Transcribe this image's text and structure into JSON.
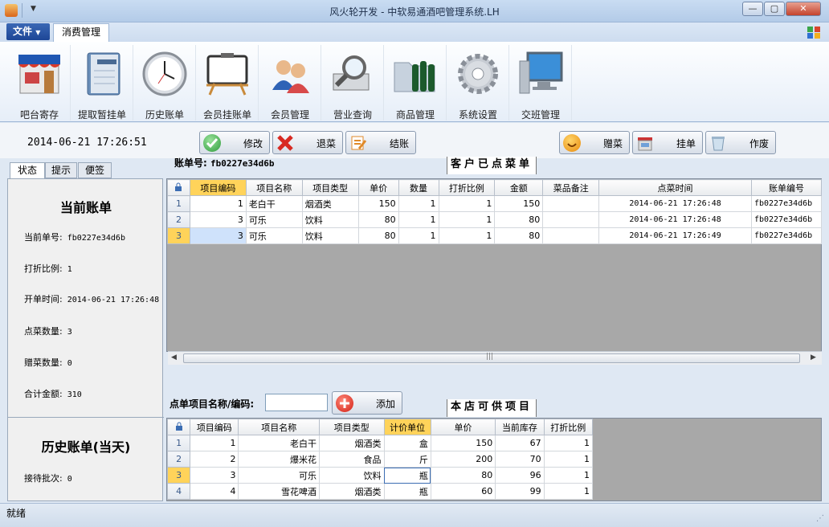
{
  "window": {
    "title": "风火轮开发 - 中软易通酒吧管理系统.LH"
  },
  "menu": {
    "file": "文件",
    "tab": "消费管理"
  },
  "ribbon": [
    {
      "label": "吧台寄存",
      "icon": "shop-icon"
    },
    {
      "label": "提取暂挂单",
      "icon": "notebook-icon"
    },
    {
      "label": "历史账单",
      "icon": "clock-icon"
    },
    {
      "label": "会员挂账单",
      "icon": "easel-board-icon"
    },
    {
      "label": "会员管理",
      "icon": "users-icon"
    },
    {
      "label": "营业查询",
      "icon": "magnifier-icon"
    },
    {
      "label": "商品管理",
      "icon": "folder-beer-icon"
    },
    {
      "label": "系统设置",
      "icon": "gear-icon"
    },
    {
      "label": "交班管理",
      "icon": "computer-icon"
    }
  ],
  "actions": {
    "datetime": "2014-06-21 17:26:51",
    "modify": "修改",
    "return": "退菜",
    "checkout": "结账",
    "gift": "赠菜",
    "hang": "挂单",
    "void": "作废"
  },
  "left_tabs": [
    "状态",
    "提示",
    "便签"
  ],
  "status": {
    "current_title": "当前账单",
    "bill_no_label": "当前单号:",
    "bill_no": "fb0227e34d6b",
    "discount_label": "打折比例:",
    "discount": "1",
    "open_time_label": "开单时间:",
    "open_time": "2014-06-21 17:26:48",
    "count_label": "点菜数量:",
    "count": "3",
    "gift_label": "赠菜数量:",
    "gift": "0",
    "total_label": "合计金额:",
    "total": "310",
    "history_title": "历史账单(当天)",
    "batch_label": "接待批次:",
    "batch": "0"
  },
  "bill": {
    "label": "账单号:",
    "no": "fb0227e34d6b",
    "section_title": "客户已点菜单"
  },
  "ordered": {
    "headers": [
      "项目编码",
      "项目名称",
      "项目类型",
      "单价",
      "数量",
      "打折比例",
      "金额",
      "菜品备注",
      "点菜时间",
      "账单编号"
    ],
    "rows": [
      {
        "n": "1",
        "code": "1",
        "name": "老白干",
        "type": "烟酒类",
        "price": "150",
        "qty": "1",
        "disc": "1",
        "amount": "150",
        "note": "",
        "time": "2014-06-21 17:26:48",
        "bill": "fb0227e34d6b"
      },
      {
        "n": "2",
        "code": "3",
        "name": "可乐",
        "type": "饮料",
        "price": "80",
        "qty": "1",
        "disc": "1",
        "amount": "80",
        "note": "",
        "time": "2014-06-21 17:26:48",
        "bill": "fb0227e34d6b"
      },
      {
        "n": "3",
        "code": "3",
        "name": "可乐",
        "type": "饮料",
        "price": "80",
        "qty": "1",
        "disc": "1",
        "amount": "80",
        "note": "",
        "time": "2014-06-21 17:26:49",
        "bill": "fb0227e34d6b"
      }
    ]
  },
  "order_input": {
    "label": "点单项目名称/编码:",
    "value": "",
    "add": "添加"
  },
  "available": {
    "section_title": "本店可供项目",
    "headers": [
      "项目编码",
      "项目名称",
      "项目类型",
      "计价单位",
      "单价",
      "当前库存",
      "打折比例"
    ],
    "rows": [
      {
        "n": "1",
        "code": "1",
        "name": "老白干",
        "type": "烟酒类",
        "unit": "盒",
        "price": "150",
        "stock": "67",
        "disc": "1"
      },
      {
        "n": "2",
        "code": "2",
        "name": "爆米花",
        "type": "食品",
        "unit": "斤",
        "price": "200",
        "stock": "70",
        "disc": "1"
      },
      {
        "n": "3",
        "code": "3",
        "name": "可乐",
        "type": "饮料",
        "unit": "瓶",
        "price": "80",
        "stock": "96",
        "disc": "1"
      },
      {
        "n": "4",
        "code": "4",
        "name": "雪花啤酒",
        "type": "烟酒类",
        "unit": "瓶",
        "price": "60",
        "stock": "99",
        "disc": "1"
      }
    ]
  },
  "statusbar": {
    "text": "就绪"
  }
}
